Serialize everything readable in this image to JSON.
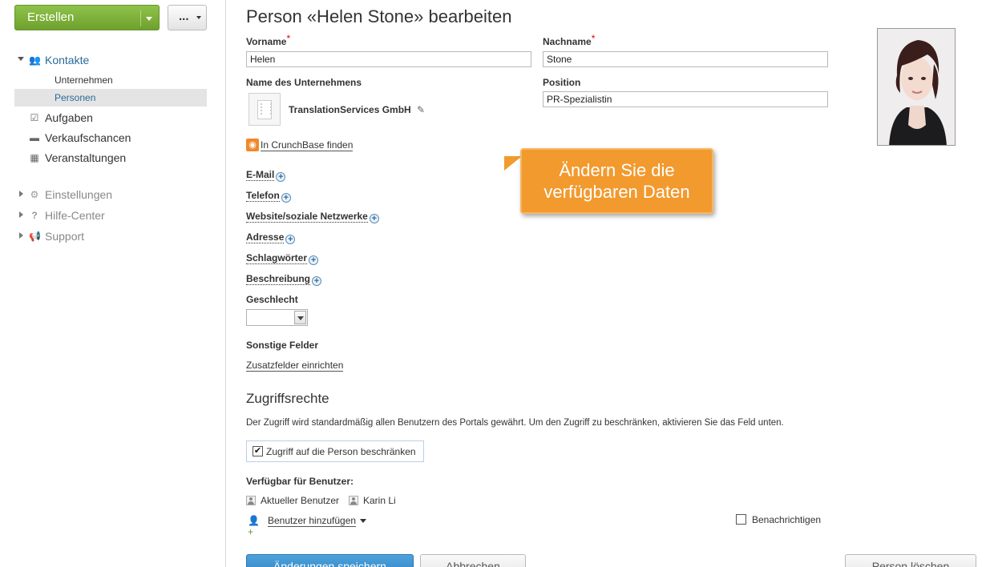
{
  "sidebar": {
    "create_label": "Erstellen",
    "more_label": "...",
    "contacts_label": "Kontakte",
    "companies_label": "Unternehmen",
    "persons_label": "Personen",
    "tasks_label": "Aufgaben",
    "opportunities_label": "Verkaufschancen",
    "events_label": "Veranstaltungen",
    "settings_label": "Einstellungen",
    "help_label": "Hilfe-Center",
    "support_label": "Support"
  },
  "page": {
    "title": "Person «Helen Stone» bearbeiten"
  },
  "form": {
    "first_name_label": "Vorname",
    "first_name_value": "Helen",
    "last_name_label": "Nachname",
    "last_name_value": "Stone",
    "required_mark": "*",
    "company_label": "Name des Unternehmens",
    "company_name": "TranslationServices GmbH",
    "position_label": "Position",
    "position_value": "PR-Spezialistin",
    "crunchbase_link": "In CrunchBase finden",
    "email_label": "E-Mail",
    "phone_label": "Telefon",
    "website_label": "Website/soziale Netzwerke",
    "address_label": "Adresse",
    "tags_label": "Schlagwörter",
    "description_label": "Beschreibung",
    "gender_label": "Geschlecht",
    "gender_value": "",
    "other_fields_label": "Sonstige Felder",
    "custom_fields_link": "Zusatzfelder einrichten"
  },
  "access": {
    "title": "Zugriffsrechte",
    "description": "Der Zugriff wird standardmäßig allen Benutzern des Portals gewährt. Um den Zugriff zu beschränken, aktivieren Sie das Feld unten.",
    "restrict_label": "Zugriff auf die Person beschränken",
    "restrict_checked": true,
    "available_label": "Verfügbar für Benutzer:",
    "users": [
      "Aktueller Benutzer",
      "Karin Li"
    ],
    "add_user_link": "Benutzer hinzufügen",
    "notify_label": "Benachrichtigen",
    "notify_checked": false
  },
  "actions": {
    "save_label": "Änderungen speichern",
    "cancel_label": "Abbrechen",
    "delete_label": "Person löschen"
  },
  "callout": {
    "line1": "Ändern Sie die",
    "line2": "verfügbaren Daten"
  },
  "colors": {
    "create_button": "#7cb342",
    "save_button": "#3b8fd0",
    "callout": "#f29a2e",
    "link_active": "#2a6b9a"
  }
}
